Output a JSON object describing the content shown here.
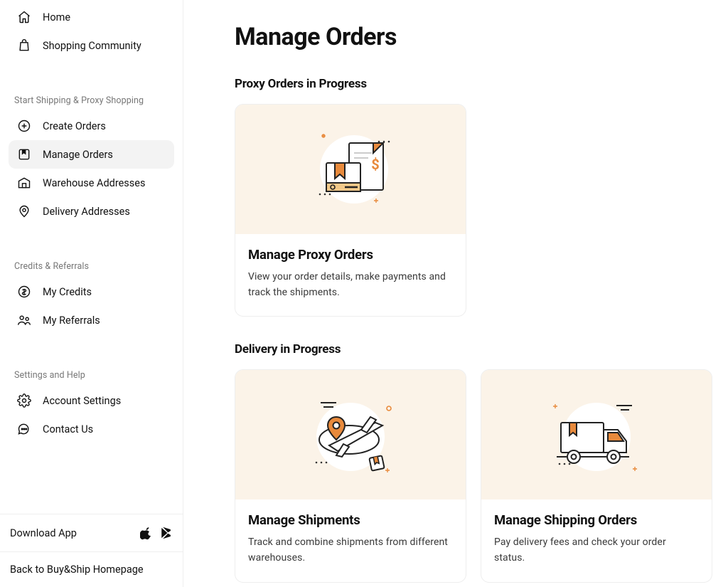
{
  "sidebar": {
    "top_items": [
      {
        "label": "Home",
        "name": "sidebar-item-home",
        "icon": "home-icon"
      },
      {
        "label": "Shopping Community",
        "name": "sidebar-item-shopping-community",
        "icon": "bag-icon"
      }
    ],
    "sections": [
      {
        "title": "Start Shipping & Proxy Shopping",
        "items": [
          {
            "label": "Create Orders",
            "name": "sidebar-item-create-orders",
            "icon": "plus-circle-icon"
          },
          {
            "label": "Manage Orders",
            "name": "sidebar-item-manage-orders",
            "icon": "box-bookmark-icon",
            "active": true
          },
          {
            "label": "Warehouse Addresses",
            "name": "sidebar-item-warehouse-addresses",
            "icon": "warehouse-icon"
          },
          {
            "label": "Delivery Addresses",
            "name": "sidebar-item-delivery-addresses",
            "icon": "pin-icon"
          }
        ]
      },
      {
        "title": "Credits & Referrals",
        "items": [
          {
            "label": "My Credits",
            "name": "sidebar-item-my-credits",
            "icon": "credits-icon"
          },
          {
            "label": "My Referrals",
            "name": "sidebar-item-my-referrals",
            "icon": "referrals-icon"
          }
        ]
      },
      {
        "title": "Settings and Help",
        "items": [
          {
            "label": "Account Settings",
            "name": "sidebar-item-account-settings",
            "icon": "gear-icon"
          },
          {
            "label": "Contact Us",
            "name": "sidebar-item-contact-us",
            "icon": "chat-icon"
          }
        ]
      }
    ],
    "download_label": "Download App",
    "homepage_label": "Back to Buy&Ship Homepage"
  },
  "main": {
    "title": "Manage Orders",
    "sections": [
      {
        "title": "Proxy Orders in Progress",
        "cards": [
          {
            "name": "card-manage-proxy-orders",
            "title": "Manage Proxy Orders",
            "desc": "View your order details, make payments and track the shipments.",
            "illustration": "proxy-orders-illustration"
          }
        ]
      },
      {
        "title": "Delivery in Progress",
        "cards": [
          {
            "name": "card-manage-shipments",
            "title": "Manage Shipments",
            "desc": "Track and combine shipments from different warehouses.",
            "illustration": "shipments-illustration"
          },
          {
            "name": "card-manage-shipping-orders",
            "title": "Manage Shipping Orders",
            "desc": "Pay delivery fees and check your order status.",
            "illustration": "shipping-orders-illustration"
          }
        ]
      }
    ]
  }
}
